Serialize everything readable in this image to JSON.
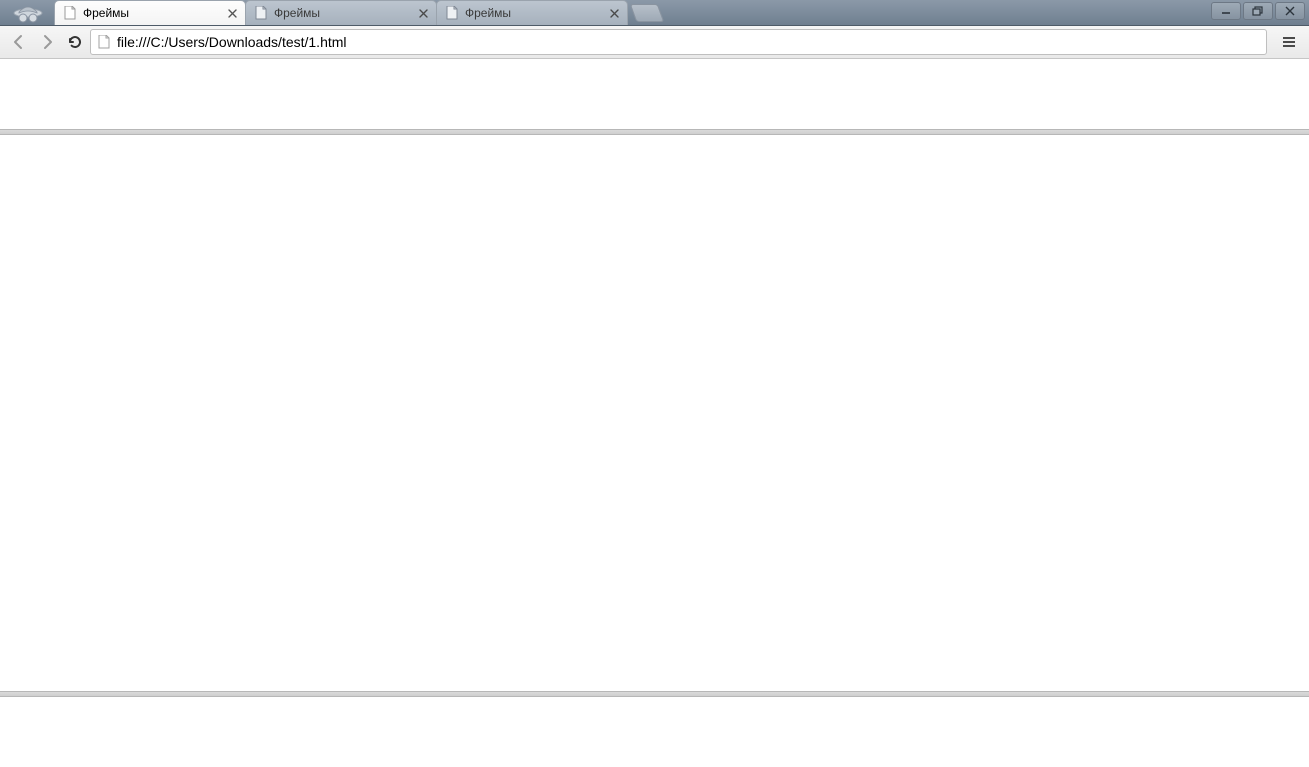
{
  "tabs": [
    {
      "title": "Фреймы",
      "active": true
    },
    {
      "title": "Фреймы",
      "active": false
    },
    {
      "title": "Фреймы",
      "active": false
    }
  ],
  "address_bar": {
    "url": "file:///C:/Users/Downloads/test/1.html"
  },
  "icons": {
    "incognito": "incognito",
    "file_favicon": "file",
    "close": "×",
    "minimize": "–",
    "maximize": "❐"
  }
}
